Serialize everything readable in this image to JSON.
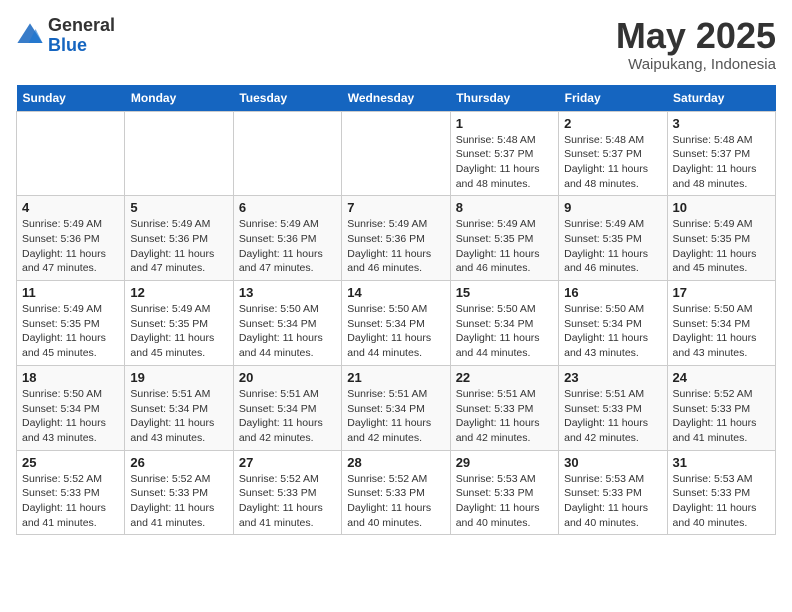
{
  "header": {
    "logo_general": "General",
    "logo_blue": "Blue",
    "month_title": "May 2025",
    "location": "Waipukang, Indonesia"
  },
  "days_of_week": [
    "Sunday",
    "Monday",
    "Tuesday",
    "Wednesday",
    "Thursday",
    "Friday",
    "Saturday"
  ],
  "weeks": [
    [
      {
        "day": "",
        "info": ""
      },
      {
        "day": "",
        "info": ""
      },
      {
        "day": "",
        "info": ""
      },
      {
        "day": "",
        "info": ""
      },
      {
        "day": "1",
        "info": "Sunrise: 5:48 AM\nSunset: 5:37 PM\nDaylight: 11 hours\nand 48 minutes."
      },
      {
        "day": "2",
        "info": "Sunrise: 5:48 AM\nSunset: 5:37 PM\nDaylight: 11 hours\nand 48 minutes."
      },
      {
        "day": "3",
        "info": "Sunrise: 5:48 AM\nSunset: 5:37 PM\nDaylight: 11 hours\nand 48 minutes."
      }
    ],
    [
      {
        "day": "4",
        "info": "Sunrise: 5:49 AM\nSunset: 5:36 PM\nDaylight: 11 hours\nand 47 minutes."
      },
      {
        "day": "5",
        "info": "Sunrise: 5:49 AM\nSunset: 5:36 PM\nDaylight: 11 hours\nand 47 minutes."
      },
      {
        "day": "6",
        "info": "Sunrise: 5:49 AM\nSunset: 5:36 PM\nDaylight: 11 hours\nand 47 minutes."
      },
      {
        "day": "7",
        "info": "Sunrise: 5:49 AM\nSunset: 5:36 PM\nDaylight: 11 hours\nand 46 minutes."
      },
      {
        "day": "8",
        "info": "Sunrise: 5:49 AM\nSunset: 5:35 PM\nDaylight: 11 hours\nand 46 minutes."
      },
      {
        "day": "9",
        "info": "Sunrise: 5:49 AM\nSunset: 5:35 PM\nDaylight: 11 hours\nand 46 minutes."
      },
      {
        "day": "10",
        "info": "Sunrise: 5:49 AM\nSunset: 5:35 PM\nDaylight: 11 hours\nand 45 minutes."
      }
    ],
    [
      {
        "day": "11",
        "info": "Sunrise: 5:49 AM\nSunset: 5:35 PM\nDaylight: 11 hours\nand 45 minutes."
      },
      {
        "day": "12",
        "info": "Sunrise: 5:49 AM\nSunset: 5:35 PM\nDaylight: 11 hours\nand 45 minutes."
      },
      {
        "day": "13",
        "info": "Sunrise: 5:50 AM\nSunset: 5:34 PM\nDaylight: 11 hours\nand 44 minutes."
      },
      {
        "day": "14",
        "info": "Sunrise: 5:50 AM\nSunset: 5:34 PM\nDaylight: 11 hours\nand 44 minutes."
      },
      {
        "day": "15",
        "info": "Sunrise: 5:50 AM\nSunset: 5:34 PM\nDaylight: 11 hours\nand 44 minutes."
      },
      {
        "day": "16",
        "info": "Sunrise: 5:50 AM\nSunset: 5:34 PM\nDaylight: 11 hours\nand 43 minutes."
      },
      {
        "day": "17",
        "info": "Sunrise: 5:50 AM\nSunset: 5:34 PM\nDaylight: 11 hours\nand 43 minutes."
      }
    ],
    [
      {
        "day": "18",
        "info": "Sunrise: 5:50 AM\nSunset: 5:34 PM\nDaylight: 11 hours\nand 43 minutes."
      },
      {
        "day": "19",
        "info": "Sunrise: 5:51 AM\nSunset: 5:34 PM\nDaylight: 11 hours\nand 43 minutes."
      },
      {
        "day": "20",
        "info": "Sunrise: 5:51 AM\nSunset: 5:34 PM\nDaylight: 11 hours\nand 42 minutes."
      },
      {
        "day": "21",
        "info": "Sunrise: 5:51 AM\nSunset: 5:34 PM\nDaylight: 11 hours\nand 42 minutes."
      },
      {
        "day": "22",
        "info": "Sunrise: 5:51 AM\nSunset: 5:33 PM\nDaylight: 11 hours\nand 42 minutes."
      },
      {
        "day": "23",
        "info": "Sunrise: 5:51 AM\nSunset: 5:33 PM\nDaylight: 11 hours\nand 42 minutes."
      },
      {
        "day": "24",
        "info": "Sunrise: 5:52 AM\nSunset: 5:33 PM\nDaylight: 11 hours\nand 41 minutes."
      }
    ],
    [
      {
        "day": "25",
        "info": "Sunrise: 5:52 AM\nSunset: 5:33 PM\nDaylight: 11 hours\nand 41 minutes."
      },
      {
        "day": "26",
        "info": "Sunrise: 5:52 AM\nSunset: 5:33 PM\nDaylight: 11 hours\nand 41 minutes."
      },
      {
        "day": "27",
        "info": "Sunrise: 5:52 AM\nSunset: 5:33 PM\nDaylight: 11 hours\nand 41 minutes."
      },
      {
        "day": "28",
        "info": "Sunrise: 5:52 AM\nSunset: 5:33 PM\nDaylight: 11 hours\nand 40 minutes."
      },
      {
        "day": "29",
        "info": "Sunrise: 5:53 AM\nSunset: 5:33 PM\nDaylight: 11 hours\nand 40 minutes."
      },
      {
        "day": "30",
        "info": "Sunrise: 5:53 AM\nSunset: 5:33 PM\nDaylight: 11 hours\nand 40 minutes."
      },
      {
        "day": "31",
        "info": "Sunrise: 5:53 AM\nSunset: 5:33 PM\nDaylight: 11 hours\nand 40 minutes."
      }
    ]
  ]
}
